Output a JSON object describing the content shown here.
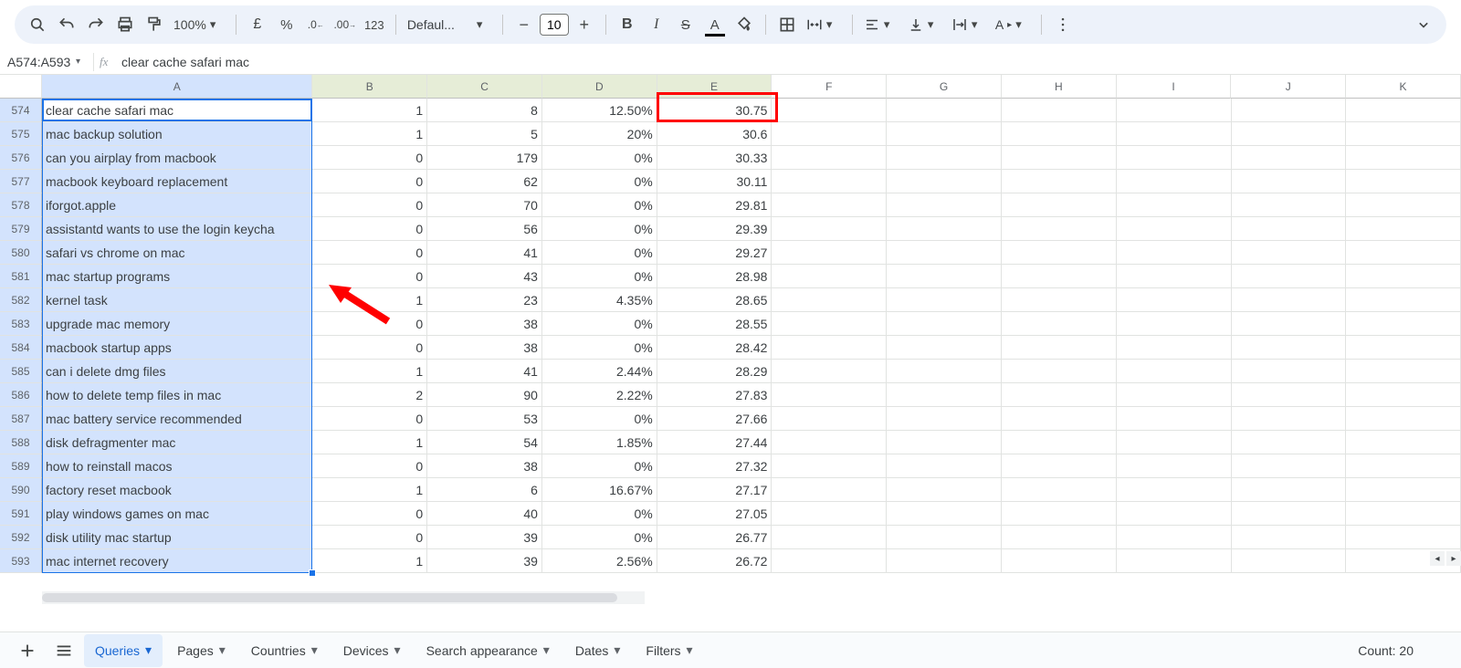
{
  "toolbar": {
    "zoom": "100%",
    "font_name": "Defaul...",
    "font_size": "10"
  },
  "name_box": "A574:A593",
  "formula": "clear cache safari mac",
  "columns": [
    "A",
    "B",
    "C",
    "D",
    "E",
    "F",
    "G",
    "H",
    "I",
    "J",
    "K"
  ],
  "rows": [
    {
      "n": "574",
      "a": "clear cache safari mac",
      "b": "1",
      "c": "8",
      "d": "12.50%",
      "e": "30.75"
    },
    {
      "n": "575",
      "a": "mac backup solution",
      "b": "1",
      "c": "5",
      "d": "20%",
      "e": "30.6"
    },
    {
      "n": "576",
      "a": "can you airplay from macbook",
      "b": "0",
      "c": "179",
      "d": "0%",
      "e": "30.33"
    },
    {
      "n": "577",
      "a": "macbook keyboard replacement",
      "b": "0",
      "c": "62",
      "d": "0%",
      "e": "30.11"
    },
    {
      "n": "578",
      "a": "iforgot.apple",
      "b": "0",
      "c": "70",
      "d": "0%",
      "e": "29.81"
    },
    {
      "n": "579",
      "a": "assistantd wants to use the login keycha",
      "b": "0",
      "c": "56",
      "d": "0%",
      "e": "29.39"
    },
    {
      "n": "580",
      "a": "safari vs chrome on mac",
      "b": "0",
      "c": "41",
      "d": "0%",
      "e": "29.27"
    },
    {
      "n": "581",
      "a": "mac startup programs",
      "b": "0",
      "c": "43",
      "d": "0%",
      "e": "28.98"
    },
    {
      "n": "582",
      "a": "kernel task",
      "b": "1",
      "c": "23",
      "d": "4.35%",
      "e": "28.65"
    },
    {
      "n": "583",
      "a": "upgrade mac memory",
      "b": "0",
      "c": "38",
      "d": "0%",
      "e": "28.55"
    },
    {
      "n": "584",
      "a": "macbook startup apps",
      "b": "0",
      "c": "38",
      "d": "0%",
      "e": "28.42"
    },
    {
      "n": "585",
      "a": "can i delete dmg files",
      "b": "1",
      "c": "41",
      "d": "2.44%",
      "e": "28.29"
    },
    {
      "n": "586",
      "a": "how to delete temp files in mac",
      "b": "2",
      "c": "90",
      "d": "2.22%",
      "e": "27.83"
    },
    {
      "n": "587",
      "a": "mac battery service recommended",
      "b": "0",
      "c": "53",
      "d": "0%",
      "e": "27.66"
    },
    {
      "n": "588",
      "a": "disk defragmenter mac",
      "b": "1",
      "c": "54",
      "d": "1.85%",
      "e": "27.44"
    },
    {
      "n": "589",
      "a": "how to reinstall macos",
      "b": "0",
      "c": "38",
      "d": "0%",
      "e": "27.32"
    },
    {
      "n": "590",
      "a": "factory reset macbook",
      "b": "1",
      "c": "6",
      "d": "16.67%",
      "e": "27.17"
    },
    {
      "n": "591",
      "a": "play windows games on mac",
      "b": "0",
      "c": "40",
      "d": "0%",
      "e": "27.05"
    },
    {
      "n": "592",
      "a": "disk utility mac startup",
      "b": "0",
      "c": "39",
      "d": "0%",
      "e": "26.77"
    },
    {
      "n": "593",
      "a": "mac internet recovery",
      "b": "1",
      "c": "39",
      "d": "2.56%",
      "e": "26.72"
    }
  ],
  "sheets": [
    {
      "name": "Queries",
      "active": true
    },
    {
      "name": "Pages",
      "active": false
    },
    {
      "name": "Countries",
      "active": false
    },
    {
      "name": "Devices",
      "active": false
    },
    {
      "name": "Search appearance",
      "active": false
    },
    {
      "name": "Dates",
      "active": false
    },
    {
      "name": "Filters",
      "active": false
    }
  ],
  "status_count": "Count: 20"
}
